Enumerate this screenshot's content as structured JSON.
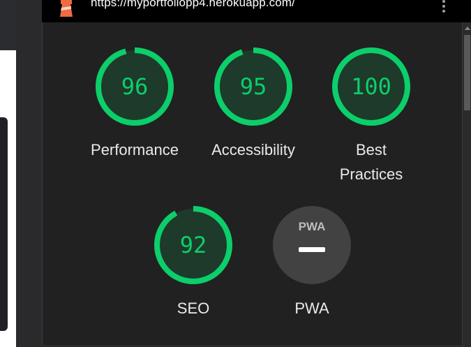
{
  "header": {
    "url": "https://myportfoliopp4.herokuapp.com/"
  },
  "colors": {
    "pass_green": "#0cce6b",
    "track": "#1e3a2b",
    "background": "#212121"
  },
  "categories": [
    {
      "id": "performance",
      "score": 96,
      "score_text": "96",
      "label": "Performance"
    },
    {
      "id": "accessibility",
      "score": 95,
      "score_text": "95",
      "label": "Accessibility"
    },
    {
      "id": "best-practices",
      "score": 100,
      "score_text": "100",
      "label_line1": "Best",
      "label_line2": "Practices"
    },
    {
      "id": "seo",
      "score": 92,
      "score_text": "92",
      "label": "SEO"
    }
  ],
  "pwa": {
    "badge_text": "PWA",
    "label": "PWA"
  },
  "icons": {
    "logo": "lighthouse-icon",
    "menu": "kebab-menu-icon"
  }
}
